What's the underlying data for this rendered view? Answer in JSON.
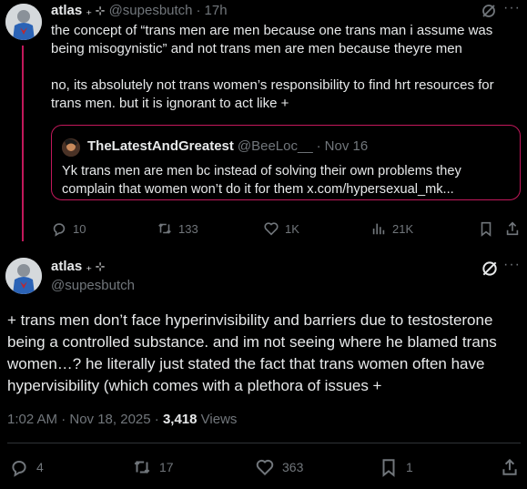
{
  "reply_tweet": {
    "name": "atlas",
    "name_suffix": "₊ ⊹",
    "handle": "@supesbutch",
    "separator": "·",
    "time": "17h",
    "para1": "the concept of “trans men are men because one trans man i assume was being misogynistic” and not trans men are men because theyre men",
    "para2": "no, its absolutely not trans women’s responsibility to find hrt resources for trans men.  but it is ignorant to act like +",
    "quote": {
      "name": "TheLatestAndGreatest",
      "handle": "@BeeLoc__",
      "separator": "·",
      "date": "Nov 16",
      "text_line1": "Yk trans men are men bc instead of solving their own problems they",
      "text_line2": "complain that women won’t do it for them x.com/hypersexual_mk..."
    },
    "stats": {
      "replies": "10",
      "retweets": "133",
      "likes": "1K",
      "views": "21K"
    },
    "icons": [
      "grok-icon",
      "more-icon",
      "reply-icon",
      "retweet-icon",
      "like-icon",
      "views-icon",
      "bookmark-icon",
      "share-icon"
    ]
  },
  "main_tweet": {
    "name": "atlas",
    "name_suffix": "₊ ⊹",
    "handle": "@supesbutch",
    "body": "+ trans men don’t face hyperinvisibility and barriers due to testosterone being a controlled substance.  and im not seeing where he blamed trans women…?  he literally just stated the fact that trans women often have hypervisibility (which comes with a plethora of issues +",
    "timestamp": "1:02 AM · Nov 18, 2025 · ",
    "views_count": "3,418",
    "views_label": "Views",
    "stats": {
      "replies": "4",
      "retweets": "17",
      "likes": "363",
      "bookmarks": "1"
    }
  },
  "colors": {
    "background": "#000000",
    "text": "#e7e9ea",
    "muted": "#71767b",
    "thread_accent": "#c2185b",
    "divider": "#2f3336"
  }
}
